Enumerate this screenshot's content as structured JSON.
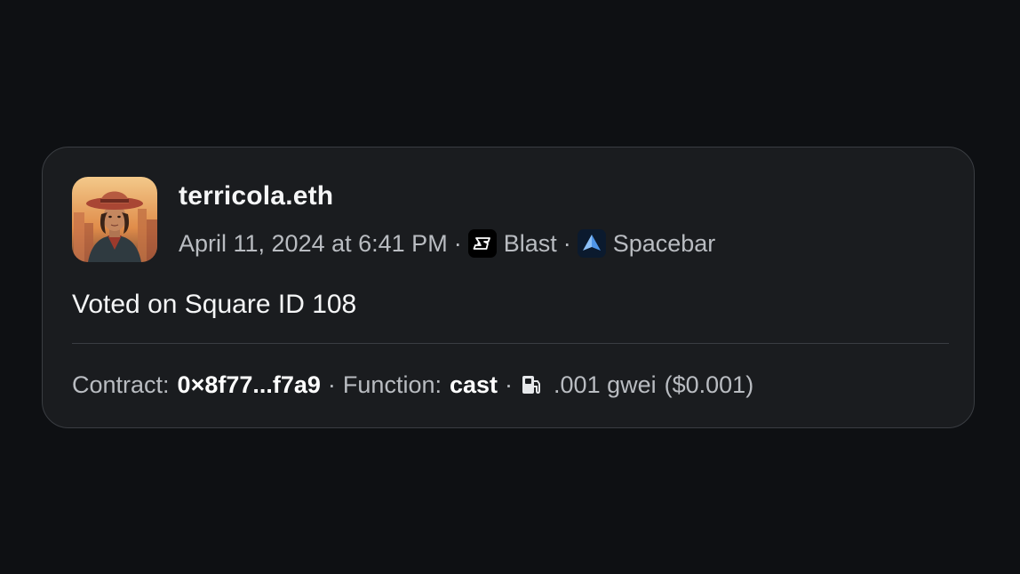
{
  "post": {
    "username": "terricola.eth",
    "date": "April 11, 2024 at 6:41 PM",
    "separator": "·",
    "chain": {
      "name": "Blast",
      "icon": "blast-logo-icon",
      "icon_bg": "#000000",
      "icon_accent": "#fcfc03"
    },
    "app": {
      "name": "Spacebar",
      "icon": "spacebar-logo-icon",
      "icon_color": "#5ea8f5"
    },
    "action_text": "Voted on Square ID 108",
    "footer": {
      "contract_label": "Contract:",
      "contract_value": "0×8f77...f7a9",
      "function_label": "Function:",
      "function_value": "cast",
      "gas_icon": "gas-pump-icon",
      "gas_value": ".001 gwei",
      "gas_usd": "($0.001)"
    }
  },
  "colors": {
    "page_bg": "#0e1013",
    "card_bg": "#1a1c1f",
    "card_border": "#3a3d42",
    "muted_text": "#b9bcc1",
    "primary_text": "#f5f6f7"
  }
}
